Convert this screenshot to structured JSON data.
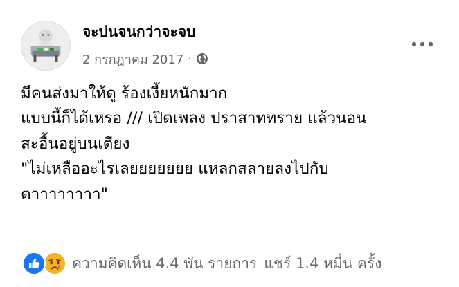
{
  "post": {
    "author": "จะบ่นจนกว่าจะจบ",
    "date": "2 กรกฎาคม 2017",
    "separator": "·",
    "privacy_icon": "globe-icon",
    "menu_icon": "more-horizontal-icon",
    "avatar_icon": "profile-picture",
    "text_lines": [
      "มีคนส่งมาให้ดู ร้องเงี้ยหนักมาก",
      "แบบนี้ก็ได้เหรอ /// เปิดเพลง ปราสาททราย แล้วนอน",
      "สะอื้นอยู่บนเตียง",
      "\"ไม่เหลืออะไรเลยยยยยยย แหลกสลายลงไปกับ",
      "ตาาาาาาาา\""
    ]
  },
  "footer": {
    "reactions": [
      "like-icon",
      "sad-icon"
    ],
    "comments": "ความคิดเห็น 4.4 พัน รายการ",
    "shares": "แชร์ 1.4 หมื่น ครั้ง"
  },
  "colors": {
    "text_primary": "#050505",
    "text_secondary": "#65676b",
    "like_blue": "#1877f2",
    "sad_yellow": "#f7b125"
  }
}
